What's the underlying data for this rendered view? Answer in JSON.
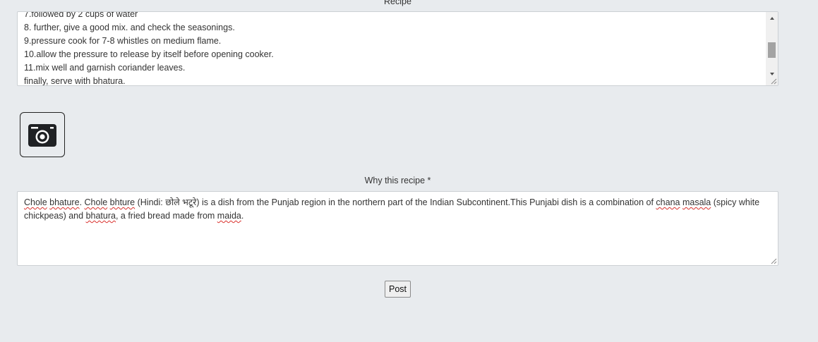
{
  "form": {
    "recipe_label": "Recipe",
    "recipe_lines": [
      "7.followed by 2 cups of water",
      "8. further, give a good mix. and check the seasonings.",
      "9.pressure cook for 7-8 whistles on medium flame.",
      "10.allow the pressure to release by itself before opening cooker.",
      "11.mix well and garnish coriander leaves."
    ],
    "recipe_last_line_prefix": "finally, serve with ",
    "recipe_last_line_word": "bhatura",
    "recipe_last_line_suffix": ".",
    "camera_icon": "camera-icon",
    "why_label": "Why this recipe *",
    "why_text_parts": {
      "w1": "Chole",
      "s1": " ",
      "w2": "bhature",
      "s2": ". ",
      "w3": "Chole",
      "s3": " ",
      "w4": "bhture",
      "s4": " (Hindi: छोले भटूरे) is a dish from the Punjab region in the northern part of the Indian Subcontinent.This Punjabi dish is a combination of ",
      "w5": "chana",
      "s5": " ",
      "w6": "masala",
      "s6": " (spicy white chickpeas) and ",
      "w7": "bhatura",
      "s7": ", a fried bread made from ",
      "w8": "maida",
      "s8": "."
    },
    "post_label": "Post"
  },
  "colors": {
    "page_background": "#e8ebee",
    "field_background": "#ffffff",
    "field_border": "#ccd0d4",
    "spellcheck_underline": "#d9302c"
  }
}
